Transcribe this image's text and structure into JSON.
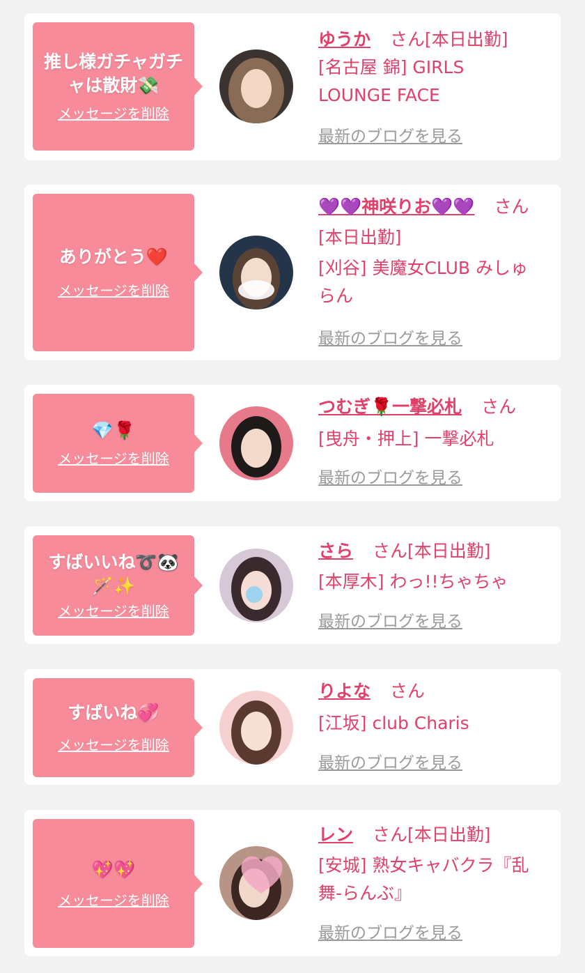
{
  "theme": {
    "accent": "#e0406a",
    "bubble": "#f78b9a",
    "card_bg": "#ffffff",
    "page_bg": "#f2f2f2",
    "link_gray": "#9a9a9a"
  },
  "common": {
    "delete_label": "メッセージを削除",
    "blog_label": "最新のブログを見る",
    "san": "さん"
  },
  "cards": [
    {
      "message_line1": "推し様ガチャガチ",
      "message_line2": "ャは散財💸",
      "name": "ゆうか",
      "attendance": "[本日出勤]",
      "shop_line1": "[名古屋 錦] GIRLS",
      "shop_line2": "LOUNGE FACE",
      "avatar_colors": [
        "#6b5448",
        "#e9c9a8"
      ]
    },
    {
      "message_line1": "ありがとう❤️",
      "name": "💜💜神咲りお💜💜",
      "attendance": "[本日出勤]",
      "shop_line1": "[刈谷] 美魔女CLUB みしゅ",
      "shop_line2": "らん",
      "avatar_colors": [
        "#243449",
        "#c7b299"
      ]
    },
    {
      "message_line1": "💎🌹",
      "name": "つむぎ🌹一撃必札",
      "shop_line1": "[曳舟・押上] 一撃必札",
      "avatar_colors": [
        "#e77a8a",
        "#1e1a1a"
      ]
    },
    {
      "message_line1": "すばいいね➰🐼",
      "message_line2": "🪄✨",
      "name": "さら",
      "attendance": "[本日出勤]",
      "shop_line1": "[本厚木] わっ!!ちゃちゃ",
      "avatar_colors": [
        "#d7c8d8",
        "#3a2a2e"
      ]
    },
    {
      "message_line1": "すばいね💞",
      "name": "りよな",
      "shop_line1": "[江坂] club Charis",
      "avatar_colors": [
        "#f6cfd0",
        "#5a3a2e"
      ]
    },
    {
      "message_line1": "💖💖",
      "name": "レン",
      "attendance": "[本日出勤]",
      "shop_line1": "[安城] 熟女キャバクラ『乱",
      "shop_line2": "舞-らんぶ』",
      "avatar_colors": [
        "#b79486",
        "#f3a9c4"
      ]
    }
  ]
}
